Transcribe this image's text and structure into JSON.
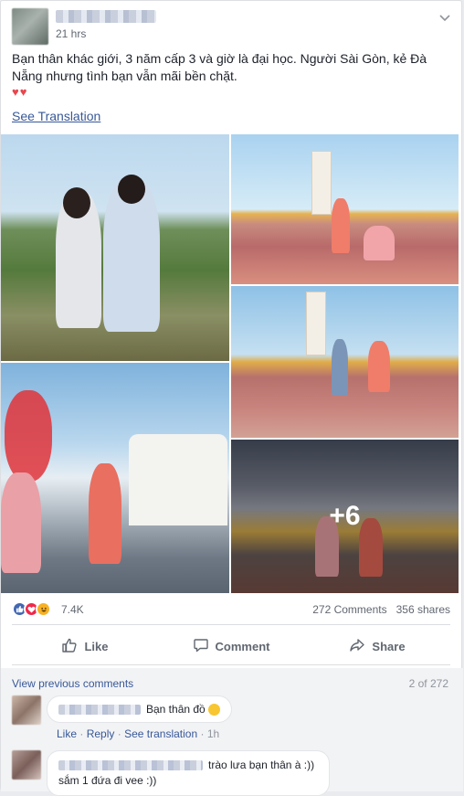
{
  "post": {
    "time": "21 hrs",
    "caption": "Bạn thân khác giới, 3 năm cấp 3 và giờ là đại học. Người Sài Gòn, kẻ Đà Nẵng nhưng tình bạn vẫn mãi bền chặt.",
    "hearts": "♥♥",
    "see_translation": "See Translation",
    "more_photos": "+6"
  },
  "stats": {
    "reactions_count": "7.4K",
    "comments_count": "272 Comments",
    "shares_count": "356 shares"
  },
  "actions": {
    "like": "Like",
    "comment": "Comment",
    "share": "Share"
  },
  "comments": {
    "view_previous": "View previous comments",
    "pager": "2 of 272",
    "items": [
      {
        "text": "Bạn thân đồ",
        "like": "Like",
        "reply": "Reply",
        "see_translation": "See translation",
        "time": "1h"
      },
      {
        "text_line1": "trào lưa bạn thân à :))",
        "text_line2": "sắm 1 đứa đi vee :))"
      }
    ]
  },
  "colors": {
    "link": "#385898",
    "like_reaction": "#4267b2",
    "love_reaction": "#f0284a",
    "haha_reaction": "#f7b125"
  },
  "icons": [
    "chevron-down-icon",
    "like-reaction-icon",
    "love-reaction-icon",
    "haha-reaction-icon",
    "thumbs-up-icon",
    "comment-icon",
    "share-icon",
    "emoji-icon"
  ]
}
